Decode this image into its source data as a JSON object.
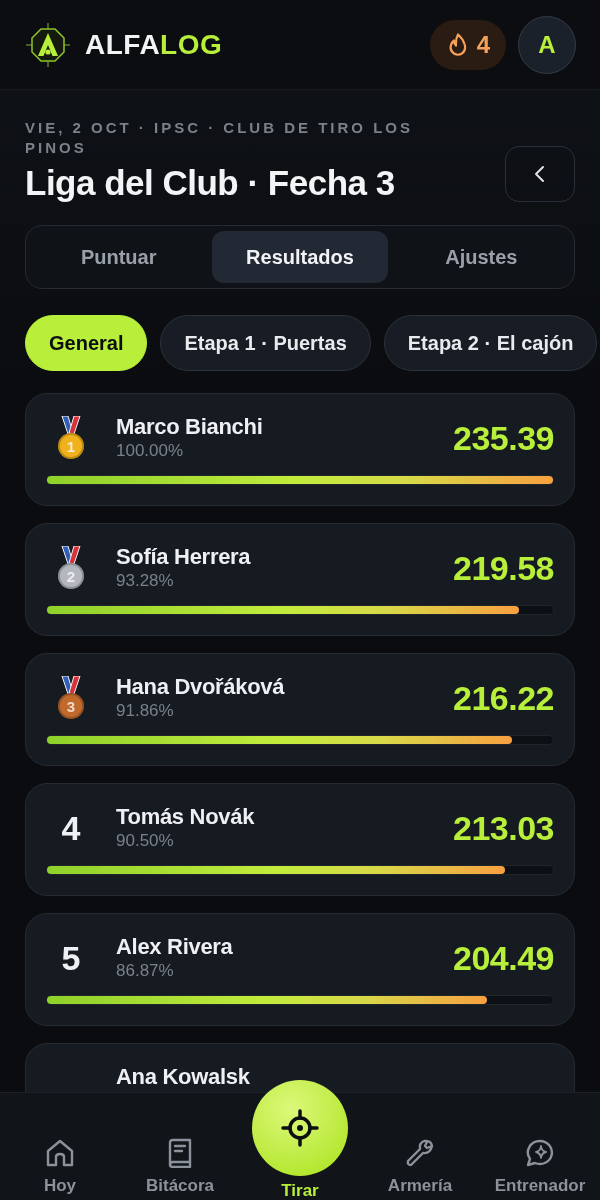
{
  "header": {
    "brand": {
      "primary": "ALFA",
      "accent": "LOG"
    },
    "streak": "4",
    "avatar": "A"
  },
  "event": {
    "subtitle": "VIE, 2 OCT · IPSC · CLUB DE TIRO LOS PINOS",
    "title": "Liga del Club · Fecha 3"
  },
  "tabs": [
    {
      "label": "Puntuar",
      "selected": false
    },
    {
      "label": "Resultados",
      "selected": true
    },
    {
      "label": "Ajustes",
      "selected": false
    }
  ],
  "filters": [
    {
      "label": "General",
      "selected": true
    },
    {
      "label": "Etapa 1 · Puertas",
      "selected": false
    },
    {
      "label": "Etapa 2 · El cajón",
      "selected": false
    }
  ],
  "results": [
    {
      "kind": "medal",
      "color": "#f0b21c",
      "rank": "1",
      "name": "Marco Bianchi",
      "percent": "100.00%",
      "score": "235.39",
      "level": 1
    },
    {
      "kind": "medal",
      "color": "#b4b8be",
      "rank": "2",
      "name": "Sofía Herrera",
      "percent": "93.28%",
      "score": "219.58",
      "level": 0.9328
    },
    {
      "kind": "medal",
      "color": "#c06a2c",
      "rank": "3",
      "name": "Hana Dvořáková",
      "percent": "91.86%",
      "score": "216.22",
      "level": 0.9186
    },
    {
      "kind": "number",
      "rank": "4",
      "name": "Tomás Novák",
      "percent": "90.50%",
      "score": "213.03",
      "level": 0.905
    },
    {
      "kind": "number",
      "rank": "5",
      "name": "Alex Rivera",
      "percent": "86.87%",
      "score": "204.49",
      "level": 0.8687
    },
    {
      "kind": "number",
      "name": "Ana Kowalsk"
    }
  ],
  "nav": [
    {
      "label": "Hoy",
      "kind": "tab",
      "selected": false
    },
    {
      "label": "Bitácora",
      "kind": "tab",
      "selected": false
    },
    {
      "label": "Tirar",
      "kind": "action",
      "selected": true
    },
    {
      "label": "Armería",
      "kind": "tab",
      "selected": false
    },
    {
      "label": "Entrenador",
      "kind": "tab",
      "selected": false
    }
  ]
}
